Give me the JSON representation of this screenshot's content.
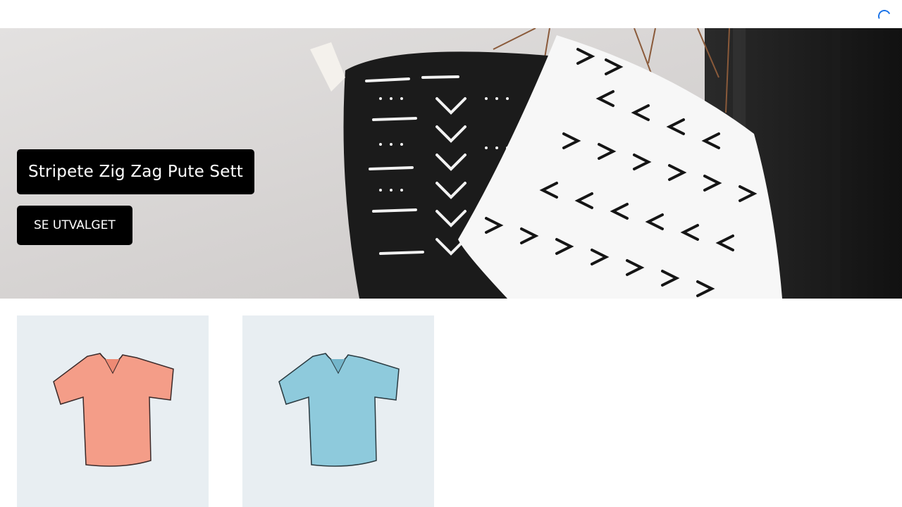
{
  "header": {
    "loading_spinner": "spinner-icon"
  },
  "hero": {
    "title": "Stripete Zig Zag Pute Sett",
    "cta_label": "SE UTVALGET",
    "image": "pillows-photo"
  },
  "products": [
    {
      "image": "coral-tshirt-image",
      "color": "#f59a86"
    },
    {
      "image": "blue-tshirt-image",
      "color": "#8cc8dc"
    }
  ],
  "colors": {
    "accent": "#1a73e8",
    "button_bg": "#000000",
    "button_text": "#ffffff",
    "card_bg": "#e8eef2"
  }
}
